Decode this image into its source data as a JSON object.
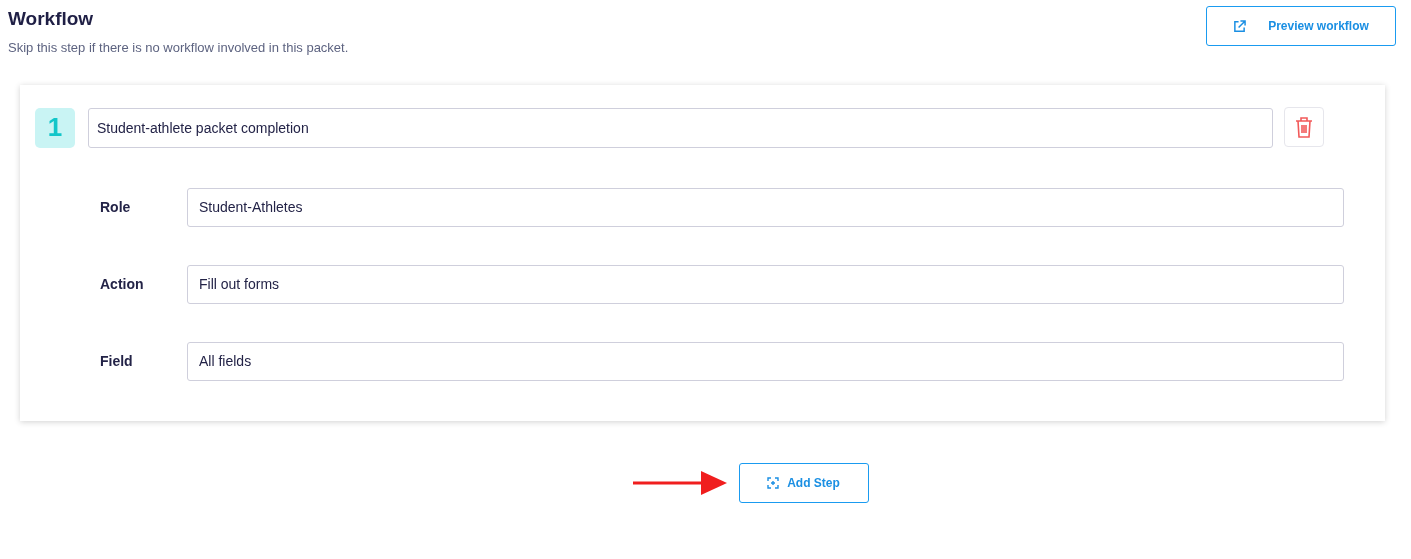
{
  "header": {
    "title": "Workflow",
    "subtitle": "Skip this step if there is no workflow involved in this packet."
  },
  "preview_button": {
    "label": "Preview workflow"
  },
  "steps": [
    {
      "number": "1",
      "title": "Student-athlete packet completion",
      "fields": [
        {
          "label": "Role",
          "value": "Student-Athletes"
        },
        {
          "label": "Action",
          "value": "Fill out forms"
        },
        {
          "label": "Field",
          "value": "All fields"
        }
      ]
    }
  ],
  "add_button": {
    "label": "Add Step"
  }
}
